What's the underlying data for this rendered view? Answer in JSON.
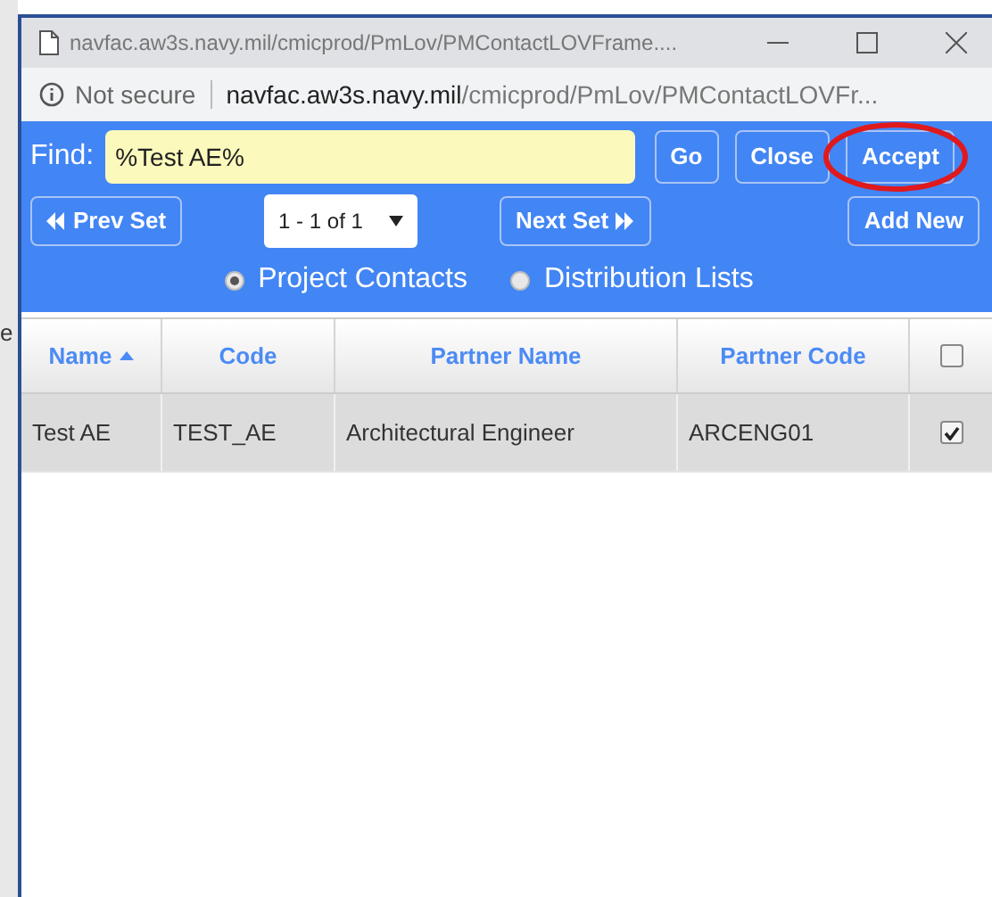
{
  "background_window": {
    "text": "e"
  },
  "window": {
    "title": "navfac.aw3s.navy.mil/cmicprod/PmLov/PMContactLOVFrame...."
  },
  "address_bar": {
    "security": "Not secure",
    "host": "navfac.aw3s.navy.mil",
    "path": "/cmicprod/PmLov/PMContactLOVFr..."
  },
  "find": {
    "label": "Find:",
    "value": "%Test AE%"
  },
  "buttons": [
    {
      "label": "Go",
      "highlighted": false
    },
    {
      "label": "Close",
      "highlighted": false
    },
    {
      "label": "Accept",
      "highlighted": true
    }
  ],
  "pager": {
    "prev": "Prev Set",
    "range": "1 - 1 of 1",
    "next": "Next Set",
    "add": "Add New"
  },
  "radios": [
    {
      "label": "Project Contacts",
      "selected": true
    },
    {
      "label": "Distribution Lists",
      "selected": false
    }
  ],
  "table": {
    "columns": [
      {
        "label": "Name",
        "sorted": true
      },
      {
        "label": "Code",
        "sorted": false
      },
      {
        "label": "Partner Name",
        "sorted": false
      },
      {
        "label": "Partner Code",
        "sorted": false
      }
    ],
    "header_checked": false,
    "rows": [
      {
        "cells": [
          "Test AE",
          "TEST_AE",
          "Architectural Engineer",
          "ARCENG01"
        ],
        "checked": true
      }
    ]
  }
}
